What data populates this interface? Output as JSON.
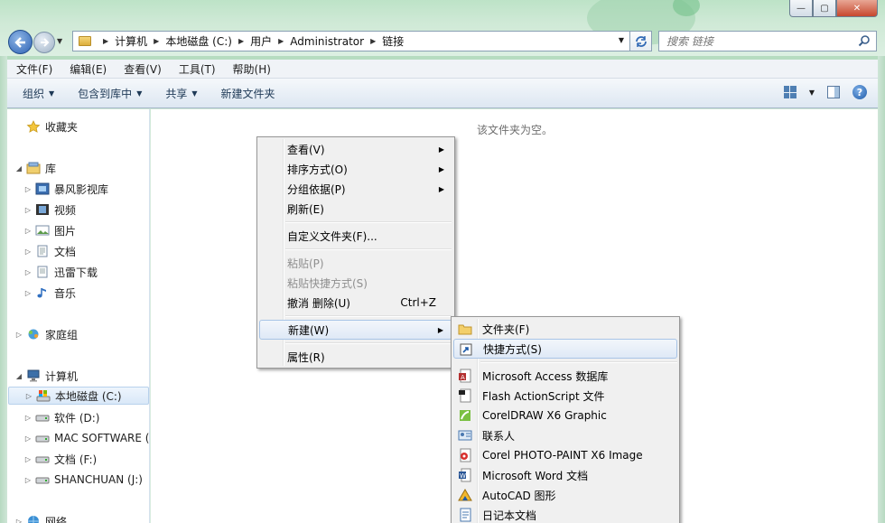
{
  "window": {
    "minimize_symbol": "—",
    "maximize_symbol": "▢",
    "close_symbol": "✕"
  },
  "address": {
    "crumbs": [
      "计算机",
      "本地磁盘 (C:)",
      "用户",
      "Administrator",
      "链接"
    ]
  },
  "search": {
    "placeholder": "搜索 链接"
  },
  "menubar": [
    "文件(F)",
    "编辑(E)",
    "查看(V)",
    "工具(T)",
    "帮助(H)"
  ],
  "toolbar": {
    "organize": "组织",
    "include_library": "包含到库中",
    "share": "共享",
    "new_folder": "新建文件夹"
  },
  "sidebar": {
    "favorites": "收藏夹",
    "library": "库",
    "library_items": [
      "暴风影视库",
      "视频",
      "图片",
      "文档",
      "迅雷下载",
      "音乐"
    ],
    "homegroup": "家庭组",
    "computer": "计算机",
    "drives": [
      "本地磁盘 (C:)",
      "软件 (D:)",
      "MAC SOFTWARE (",
      "文档 (F:)",
      "SHANCHUAN (J:)"
    ],
    "network": "网络"
  },
  "content": {
    "empty_message": "该文件夹为空。"
  },
  "context_menu": {
    "view": "查看(V)",
    "sort": "排序方式(O)",
    "group": "分组依据(P)",
    "refresh": "刷新(E)",
    "customize": "自定义文件夹(F)...",
    "paste": "粘贴(P)",
    "paste_shortcut": "粘贴快捷方式(S)",
    "undo_delete": "撤消 删除(U)",
    "undo_shortcut": "Ctrl+Z",
    "new": "新建(W)",
    "properties": "属性(R)"
  },
  "new_submenu": {
    "folder": "文件夹(F)",
    "shortcut": "快捷方式(S)",
    "items": [
      "Microsoft Access 数据库",
      "Flash ActionScript 文件",
      "CorelDRAW X6 Graphic",
      "联系人",
      "Corel PHOTO-PAINT X6 Image",
      "Microsoft Word 文档",
      "AutoCAD 图形",
      "日记本文档"
    ]
  },
  "colors": {
    "accent": "#1d5aa8",
    "highlight_border": "#a8c4e6",
    "frame": "#bde3c7"
  }
}
